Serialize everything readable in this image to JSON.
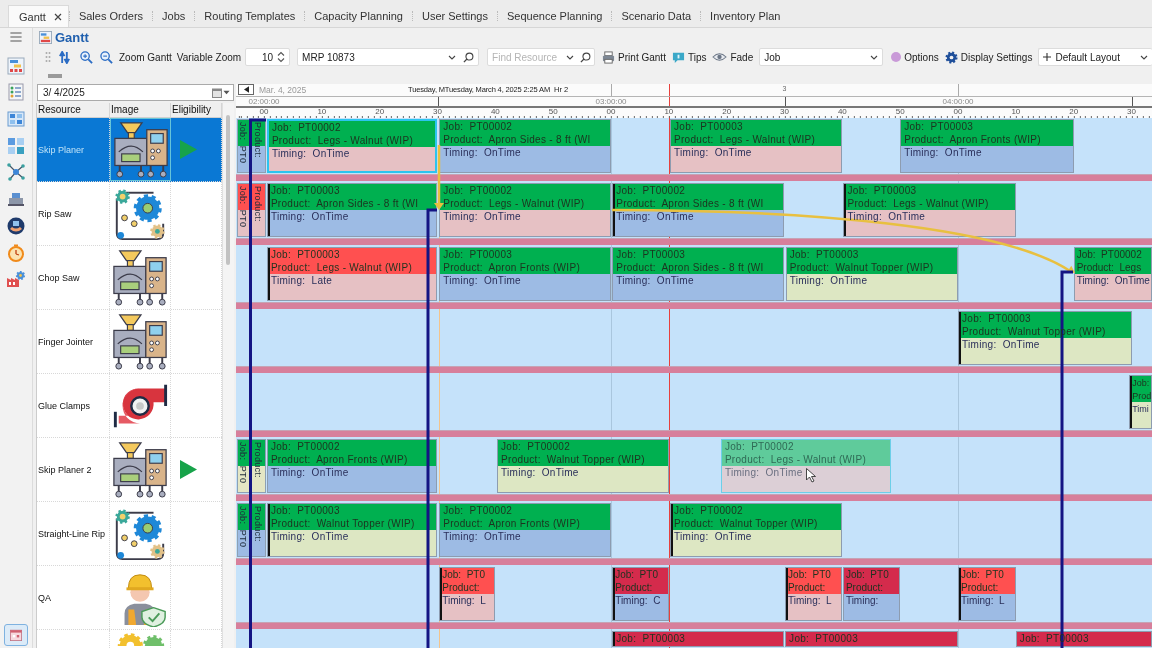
{
  "tabs": [
    {
      "label": "Gantt",
      "selected": true,
      "closable": true
    },
    {
      "label": "Sales Orders",
      "selected": false,
      "closable": false
    },
    {
      "label": "Jobs",
      "selected": false,
      "closable": false
    },
    {
      "label": "Routing Templates",
      "selected": false,
      "closable": false
    },
    {
      "label": "Capacity Planning",
      "selected": false,
      "closable": false
    },
    {
      "label": "User Settings",
      "selected": false,
      "closable": false
    },
    {
      "label": "Sequence Planning",
      "selected": false,
      "closable": false
    },
    {
      "label": "Scenario Data",
      "selected": false,
      "closable": false
    },
    {
      "label": "Inventory Plan",
      "selected": false,
      "closable": false
    }
  ],
  "sidebar": {
    "items": [
      {
        "kind": "menu",
        "selected": false
      },
      {
        "kind": "gantt",
        "selected": false
      },
      {
        "kind": "list",
        "selected": false
      },
      {
        "kind": "board",
        "selected": false
      },
      {
        "kind": "grid",
        "selected": false
      },
      {
        "kind": "network",
        "selected": false
      },
      {
        "kind": "machine",
        "selected": false
      },
      {
        "kind": "support",
        "selected": false
      },
      {
        "kind": "timer",
        "selected": false
      },
      {
        "kind": "dashboard",
        "selected": false
      },
      {
        "kind": "calendar",
        "selected": true
      }
    ]
  },
  "page": {
    "title": "Gantt"
  },
  "toolbar": {
    "zoom_gantt": "Zoom Gantt",
    "variable_zoom": "Variable Zoom",
    "zoom_value": "10",
    "mrp": {
      "value": "MRP 10873"
    },
    "find_resource": {
      "placeholder": "Find Resource"
    },
    "print": "Print Gantt",
    "tips": "Tips",
    "fade": "Fade",
    "fade_by": {
      "value": "Job"
    },
    "options": "Options",
    "display_settings": "Display Settings",
    "layout": {
      "value": "Default Layout"
    }
  },
  "date_field": {
    "value": "3/ 4/2025"
  },
  "resource_table": {
    "columns": [
      "Resource",
      "Image",
      "Eligibility"
    ],
    "rows": [
      {
        "name": "Skip Planer",
        "kind": "machine",
        "eligible": true,
        "selected": true
      },
      {
        "name": "Rip Saw",
        "kind": "conveyor",
        "eligible": false,
        "selected": false
      },
      {
        "name": "Chop Saw",
        "kind": "machine",
        "eligible": false,
        "selected": false
      },
      {
        "name": "Finger Jointer",
        "kind": "machine",
        "eligible": false,
        "selected": false
      },
      {
        "name": "Glue Clamps",
        "kind": "pump",
        "eligible": false,
        "selected": false
      },
      {
        "name": "Skip Planer 2",
        "kind": "machine",
        "eligible": true,
        "selected": false
      },
      {
        "name": "Straight-Line Rip",
        "kind": "conveyor",
        "eligible": false,
        "selected": false
      },
      {
        "name": "QA",
        "kind": "worker",
        "eligible": false,
        "selected": false
      },
      {
        "kind": "gears",
        "eligible": false,
        "selected": false
      }
    ]
  },
  "timeline": {
    "date": "Mar. 4, 2025",
    "caption": "Tuesday, MTuesday, March 4, 2025 2:25 AM",
    "hour_caption": "Hr 2",
    "day_marker": "3",
    "hours": [
      "02:00:00",
      "03:00:00",
      "04:00:00"
    ],
    "minutes": [
      "00",
      "10",
      "20",
      "30",
      "40",
      "50",
      "00",
      "10",
      "20",
      "30",
      "40",
      "50",
      "00",
      "10",
      "20",
      "30"
    ]
  },
  "gantt_rows": [
    {
      "stub": {
        "job": "Job:  PT0",
        "product": "Product:",
        "color": "#00b050",
        "body": {
          "color": "#9dbbe4"
        }
      },
      "blocks": [
        {
          "job": "Job:  PT00002",
          "product": "Product:  Legs - Walnut (WIP)",
          "timing": {
            "label": "Timing:  OnTime",
            "color": "#e6c1c4"
          },
          "color": "#00b050",
          "edge_marker": false,
          "selected": true,
          "dragging": false
        },
        {
          "job": "Job:  PT00002",
          "product": "Product:  Apron Sides - 8 ft (WI",
          "timing": {
            "label": "Timing:  OnTime",
            "color": "#9dbbe4"
          },
          "color": "#00b050",
          "edge_marker": false,
          "selected": false,
          "dragging": false
        },
        {
          "job": "Job:  PT00003",
          "product": "Product:  Legs - Walnut (WIP)",
          "timing": {
            "label": "Timing:  OnTime",
            "color": "#e6c1c4"
          },
          "color": "#00b050",
          "edge_marker": false,
          "selected": false,
          "dragging": false
        },
        {
          "job": "Job:  PT00003",
          "product": "Product:  Apron Fronts (WIP)",
          "timing": {
            "label": "Timing:  OnTime",
            "color": "#9dbbe4"
          },
          "color": "#00b050",
          "edge_marker": false,
          "selected": false,
          "dragging": false
        }
      ]
    },
    {
      "stub": {
        "job": "Job:  PT0",
        "product": "Product:",
        "color": "#ff5050",
        "body": {
          "color": "#e6c1c4"
        }
      },
      "blocks": [
        {
          "job": "Job:  PT00003",
          "product": "Product:  Apron Sides - 8 ft (WI",
          "timing": {
            "label": "Timing:  OnTime",
            "color": "#9dbbe4"
          },
          "color": "#00b050",
          "edge_marker": true,
          "selected": false,
          "dragging": false
        },
        {
          "job": "Job:  PT00002",
          "product": "Product:  Legs - Walnut (WIP)",
          "timing": {
            "label": "Timing:  OnTime",
            "color": "#e6c1c4"
          },
          "color": "#00b050",
          "edge_marker": false,
          "selected": false,
          "dragging": false
        },
        {
          "job": "Job:  PT00002",
          "product": "Product:  Apron Sides - 8 ft (WI",
          "timing": {
            "label": "Timing:  OnTime",
            "color": "#9dbbe4"
          },
          "color": "#00b050",
          "edge_marker": true,
          "selected": false,
          "dragging": false
        },
        {
          "job": "Job:  PT00003",
          "product": "Product:  Legs - Walnut (WIP)",
          "timing": {
            "label": "Timing:  OnTime",
            "color": "#e6c1c4"
          },
          "color": "#00b050",
          "edge_marker": true,
          "selected": false,
          "dragging": false
        }
      ]
    },
    {
      "blocks": [
        {
          "job": "Job:  PT00003",
          "product": "Product:  Legs - Walnut (WIP)",
          "timing": {
            "label": "Timing:  Late",
            "color": "#e6c1c4"
          },
          "color": "#ff5050",
          "edge_marker": true,
          "selected": false,
          "dragging": false
        },
        {
          "job": "Job:  PT00003",
          "product": "Product:  Apron Fronts (WIP)",
          "timing": {
            "label": "Timing:  OnTime",
            "color": "#9dbbe4"
          },
          "color": "#00b050",
          "edge_marker": false,
          "selected": false,
          "dragging": false
        },
        {
          "job": "Job:  PT00003",
          "product": "Product:  Apron Sides - 8 ft (WI",
          "timing": {
            "label": "Timing:  OnTime",
            "color": "#9dbbe4"
          },
          "color": "#00b050",
          "edge_marker": false,
          "selected": false,
          "dragging": false
        },
        {
          "job": "Job:  PT00003",
          "product": "Product:  Walnut Topper (WIP)",
          "timing": {
            "label": "Timing:  OnTime",
            "color": "#dde7c3"
          },
          "color": "#00b050",
          "edge_marker": false,
          "selected": false,
          "dragging": false
        },
        {
          "job": "Job:  PT00002",
          "product": "Product:  Legs",
          "timing": {
            "label": "Timing:  OnTime",
            "color": "#e6c1c4"
          },
          "color": "#00b050",
          "edge_marker": false,
          "selected": false,
          "dragging": false
        }
      ]
    },
    {
      "blocks": [
        {
          "job": "Job:  PT00003",
          "product": "Product:  Walnut Topper (WIP)",
          "timing": {
            "label": "Timing:  OnTime",
            "color": "#dde7c3"
          },
          "color": "#00b050",
          "edge_marker": true,
          "selected": false,
          "dragging": false
        }
      ]
    },
    {
      "blocks": [
        {
          "job": "Job:",
          "product": "Prod",
          "timing": {
            "label": "Timi",
            "color": "#dde7c3"
          },
          "color": "#00b050",
          "edge_marker": true,
          "selected": false,
          "dragging": false
        }
      ]
    },
    {
      "stub": {
        "job": "Job:  PT0",
        "product": "Product:",
        "color": "#00b050",
        "body": {
          "color": "#e4e6c4"
        }
      },
      "blocks": [
        {
          "job": "Job:  PT00002",
          "product": "Product:  Apron Fronts (WIP)",
          "timing": {
            "label": "Timing:  OnTime",
            "color": "#9dbbe4"
          },
          "color": "#00b050",
          "edge_marker": false,
          "selected": false,
          "dragging": false
        },
        {
          "job": "Job:  PT00002",
          "product": "Product:  Walnut Topper (WIP)",
          "timing": {
            "label": "Timing:  OnTime",
            "color": "#dde7c3"
          },
          "color": "#00b050",
          "edge_marker": false,
          "selected": false,
          "dragging": false
        },
        {
          "job": "Job:  PT00002",
          "product": "Product:  Legs - Walnut (WIP)",
          "timing": {
            "label": "Timing:  OnTime",
            "color": "#dccfd6"
          },
          "color": "#5fcb9b",
          "edge_marker": false,
          "selected": false,
          "dragging": true
        }
      ]
    },
    {
      "stub": {
        "job": "Job:  PT0",
        "product": "Product:",
        "color": "#00b050",
        "body": {
          "color": "#9dbbe4"
        }
      },
      "blocks": [
        {
          "job": "Job:  PT00003",
          "product": "Product:  Walnut Topper (WIP)",
          "timing": {
            "label": "Timing:  OnTime",
            "color": "#dde7c3"
          },
          "color": "#00b050",
          "edge_marker": true,
          "selected": false,
          "dragging": false
        },
        {
          "job": "Job:  PT00002",
          "product": "Product:  Apron Fronts (WIP)",
          "timing": {
            "label": "Timing:  OnTime",
            "color": "#9dbbe4"
          },
          "color": "#00b050",
          "edge_marker": false,
          "selected": false,
          "dragging": false
        },
        {
          "job": "Job:  PT00002",
          "product": "Product:  Walnut Topper (WIP)",
          "timing": {
            "label": "Timing:  OnTime",
            "color": "#dde7c3"
          },
          "color": "#00b050",
          "edge_marker": true,
          "selected": false,
          "dragging": false
        }
      ]
    },
    {
      "blocks": [
        {
          "job": "Job:  PT0",
          "product": "Product:",
          "timing": {
            "label": "Timing:  L",
            "color": "#e6c1c4"
          },
          "color": "#ff5050",
          "edge_marker": true,
          "selected": false,
          "dragging": false
        },
        {
          "job": "Job:  PT0",
          "product": "Product:",
          "timing": {
            "label": "Timing:  C",
            "color": "#9dbbe4"
          },
          "color": "#d42b4c",
          "edge_marker": true,
          "selected": false,
          "dragging": false
        },
        {
          "job": "Job:  PT0",
          "product": "Product:",
          "timing": {
            "label": "Timing:  L",
            "color": "#e6c1c4"
          },
          "color": "#ff5050",
          "edge_marker": true,
          "selected": false,
          "dragging": false
        },
        {
          "job": "Job:  PT0",
          "product": "Product:",
          "timing": {
            "label": "Timing:",
            "color": "#9dbbe4"
          },
          "color": "#d42b4c",
          "edge_marker": false,
          "selected": false,
          "dragging": false
        },
        {
          "job": "Job:  PT0",
          "product": "Product:",
          "timing": {
            "label": "Timing:  L",
            "color": "#9dbbe4"
          },
          "color": "#ff5050",
          "edge_marker": true,
          "selected": false,
          "dragging": false
        }
      ]
    },
    {
      "blocks": [
        {
          "job": "Job:  PT00003",
          "color": "#d42b4c",
          "edge_marker": true,
          "selected": false,
          "dragging": false
        },
        {
          "job": "Job:  PT00003",
          "color": "#d42b4c",
          "edge_marker": false,
          "selected": false,
          "dragging": false
        },
        {
          "job": "Job:  PT00003",
          "color": "#d42b4c",
          "edge_marker": false,
          "selected": false,
          "dragging": false
        }
      ]
    }
  ]
}
